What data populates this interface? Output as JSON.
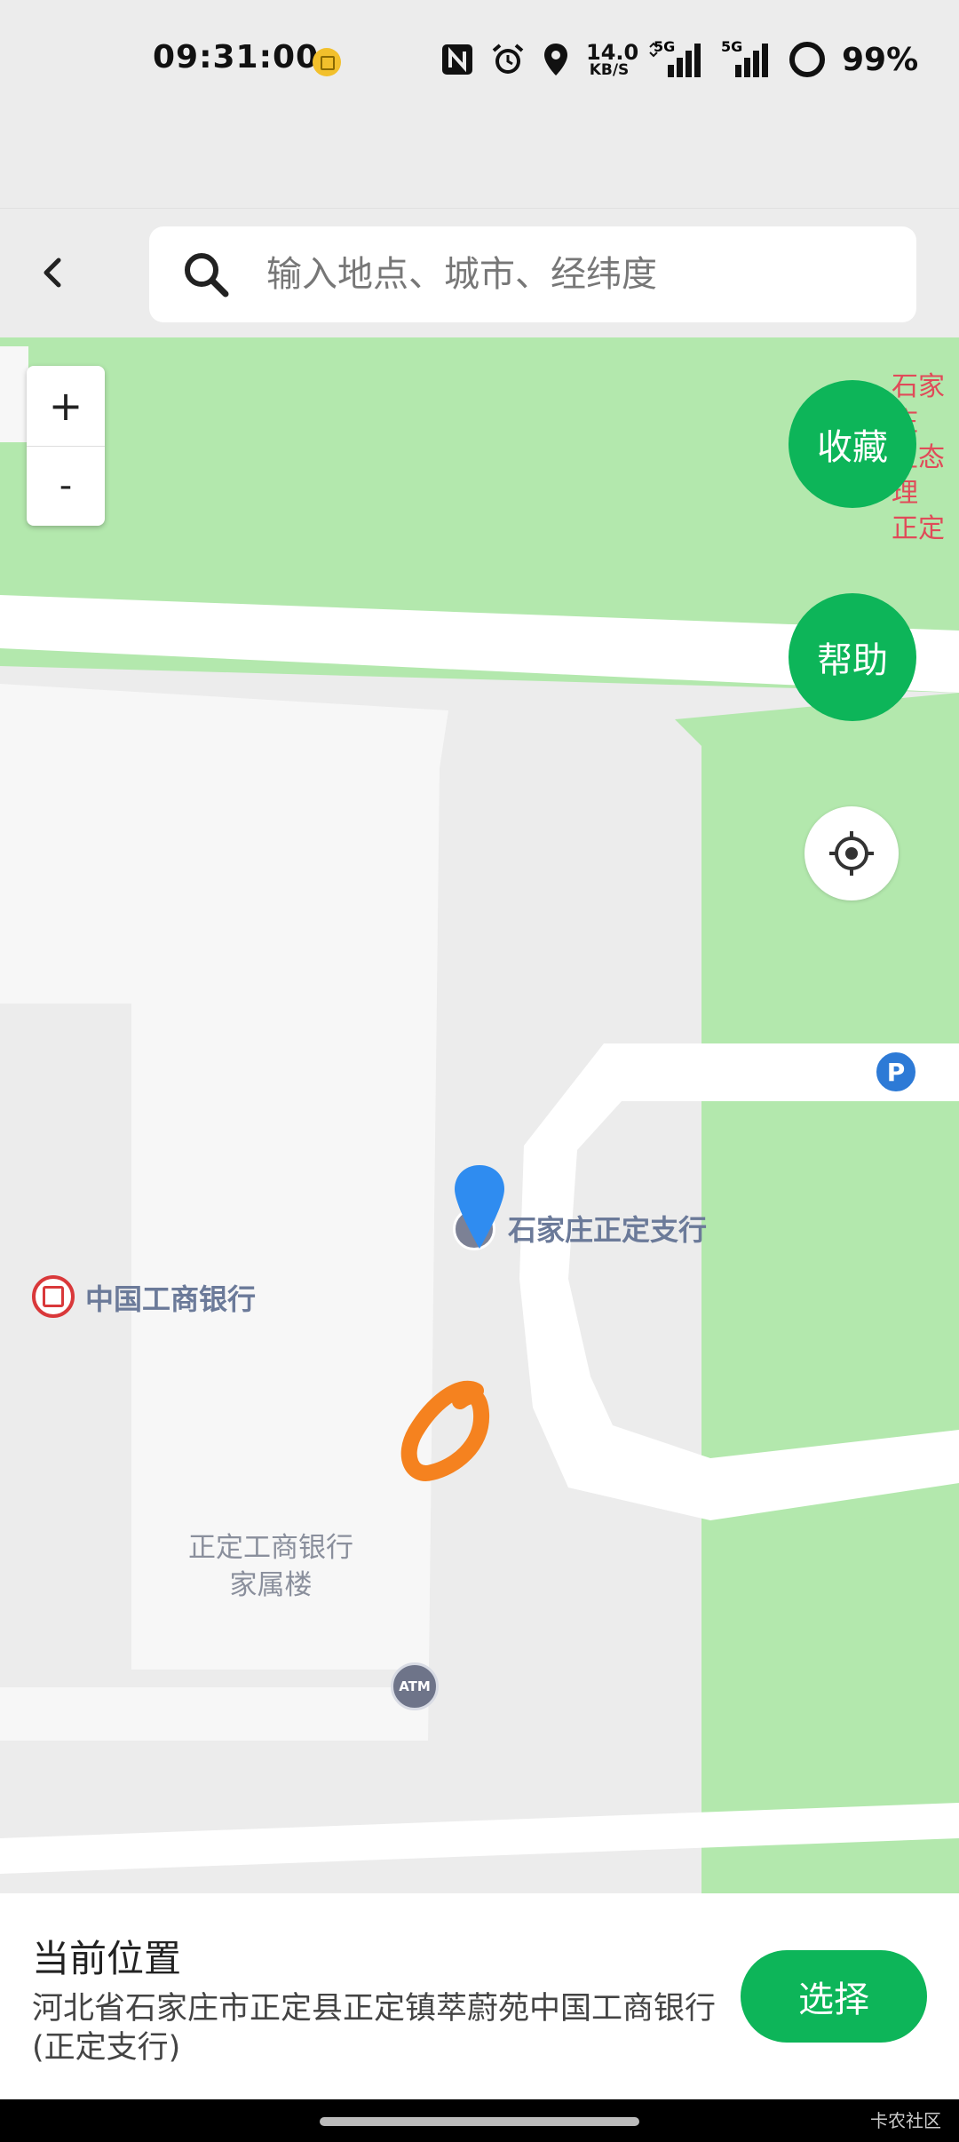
{
  "status_bar": {
    "time": "09:31:00",
    "net_speed_value": "14.0",
    "net_speed_unit": "KB/S",
    "net_label_1": "5G",
    "net_label_2": "5G",
    "battery": "99%",
    "icons": [
      "notification-icon",
      "nfc-icon",
      "alarm-icon",
      "location-icon",
      "signal-icon",
      "signal-icon",
      "battery-icon"
    ]
  },
  "header": {
    "search_placeholder": "输入地点、城市、经纬度"
  },
  "map": {
    "zoom_in_label": "+",
    "zoom_out_label": "-",
    "favorite_label": "收藏",
    "help_label": "帮助",
    "poi_selected": "石家庄正定支行",
    "poi_bank": "中国工商银行",
    "building_label_line1": "正定工商银行",
    "building_label_line2": "家属楼",
    "atm_label": "ATM",
    "parking_label": "P",
    "edge_label_line1": "石家庄",
    "edge_label_line2": "生态理",
    "edge_label_line3": "正定",
    "colors": {
      "green_area": "#b3e8ad",
      "road": "#ffffff",
      "block": "#f7f7f7",
      "accent": "#0db559",
      "pin": "#2f8cf0",
      "marker": "#f5821f"
    }
  },
  "panel": {
    "title": "当前位置",
    "address": "河北省石家庄市正定县正定镇萃蔚苑中国工商银行(正定支行)",
    "select_label": "选择"
  },
  "footer": {
    "watermark": "卡农社区"
  }
}
